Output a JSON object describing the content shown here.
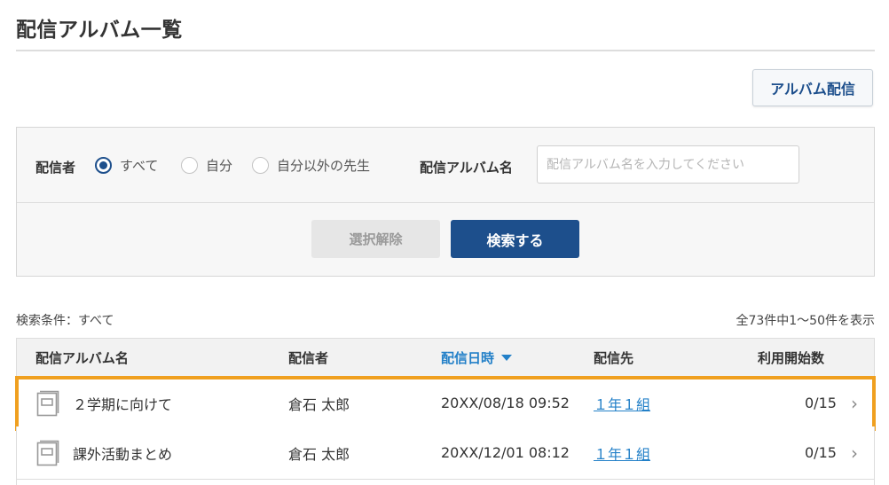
{
  "page": {
    "title": "配信アルバム一覧"
  },
  "toolbar": {
    "album_button_label": "アルバム配信"
  },
  "search": {
    "sender_label": "配信者",
    "sender_options": [
      {
        "label": "すべて",
        "checked": true
      },
      {
        "label": "自分",
        "checked": false
      },
      {
        "label": "自分以外の先生",
        "checked": false
      }
    ],
    "album_name_label": "配信アルバム名",
    "album_name_value": "",
    "album_name_placeholder": "配信アルバム名を入力してください",
    "clear_label": "選択解除",
    "search_label": "検索する"
  },
  "results": {
    "criteria": "検索条件：すべて",
    "count": "全73件中1〜50件を表示"
  },
  "table": {
    "columns": {
      "name": "配信アルバム名",
      "sender": "配信者",
      "datetime": "配信日時",
      "destination": "配信先",
      "usage": "利用開始数"
    },
    "sort": {
      "column": "datetime",
      "direction": "desc"
    },
    "rows": [
      {
        "name": "２学期に向けて",
        "sender": "倉石 太郎",
        "datetime": "20XX/08/18 09:52",
        "destination": "１年１組",
        "usage": "0/15",
        "highlighted": true
      },
      {
        "name": "課外活動まとめ",
        "sender": "倉石 太郎",
        "datetime": "20XX/12/01 08:12",
        "destination": "１年１組",
        "usage": "0/15",
        "highlighted": false
      }
    ]
  },
  "colors": {
    "accent": "#1d4f8c",
    "link": "#2380c8",
    "highlight": "#f0a020"
  },
  "icons": {
    "album": "album-book-icon",
    "row_chevron": "chevron-right-icon",
    "sort": "caret-down-icon"
  }
}
